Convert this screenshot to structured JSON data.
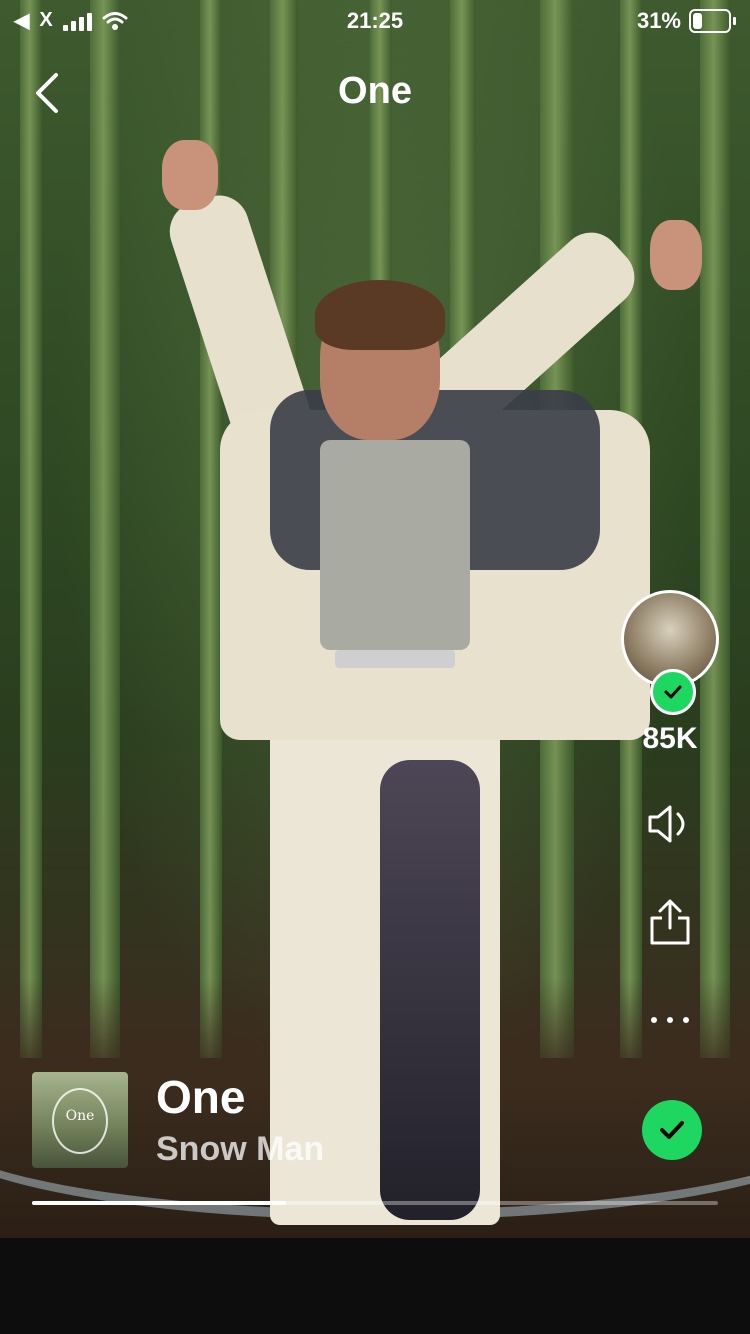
{
  "status_bar": {
    "back_app": "X",
    "time": "21:25",
    "battery_text": "31%",
    "battery_level": 0.31
  },
  "header": {
    "title": "One",
    "back_icon": "chevron-left-icon"
  },
  "side_actions": {
    "artist_avatar_icon": "artist-avatar",
    "follow_check_icon": "check-icon",
    "like_count": "85K",
    "volume_icon": "speaker-icon",
    "share_icon": "share-icon",
    "more_icon": "more-dots-icon"
  },
  "track": {
    "title": "One",
    "artist": "Snow Man",
    "cover_text": "One",
    "saved_icon": "check-icon"
  },
  "playback": {
    "progress": 0.37
  },
  "colors": {
    "accent": "#1ed760",
    "background": "#0d0d0d"
  }
}
